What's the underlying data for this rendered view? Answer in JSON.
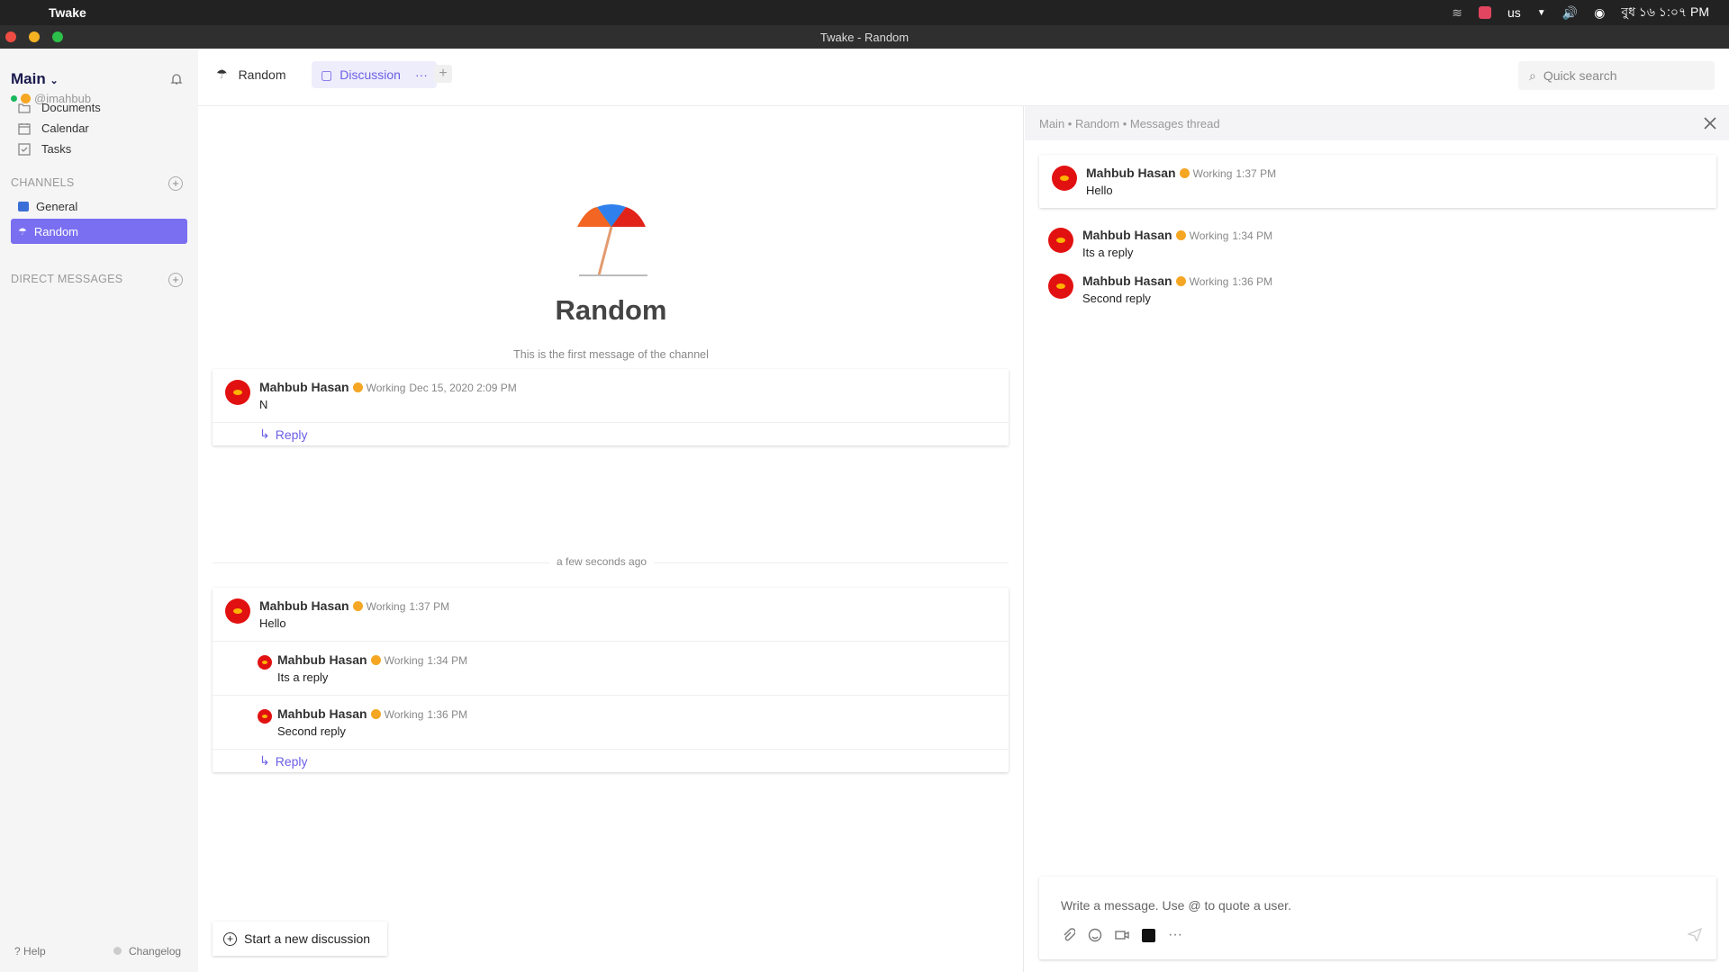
{
  "os": {
    "app_name": "Twake",
    "window_title": "Twake - Random",
    "keyboard": "us",
    "clock": "বুধ ১৬ ১:০৭ PM"
  },
  "sidebar": {
    "workspace": "Main",
    "username": "@imahbub",
    "nav": [
      {
        "label": "Documents"
      },
      {
        "label": "Calendar"
      },
      {
        "label": "Tasks"
      }
    ],
    "channels_heading": "CHANNELS",
    "channels": [
      {
        "label": "General"
      },
      {
        "label": "Random",
        "active": true
      }
    ],
    "dm_heading": "DIRECT MESSAGES",
    "help": "Help",
    "changelog": "Changelog"
  },
  "header": {
    "channel": "Random",
    "tab": "Discussion",
    "search_placeholder": "Quick search"
  },
  "intro": {
    "title": "Random",
    "subtitle": "This is the first message of the channel"
  },
  "separator": "a few seconds ago",
  "messages": [
    {
      "author": "Mahbub Hasan",
      "status": "Working",
      "time": "Dec 15, 2020 2:09 PM",
      "text": "N",
      "reply": "Reply"
    },
    {
      "author": "Mahbub Hasan",
      "status": "Working",
      "time": "1:37 PM",
      "text": "Hello",
      "reply": "Reply",
      "replies": [
        {
          "author": "Mahbub Hasan",
          "status": "Working",
          "time": "1:34 PM",
          "text": "Its a reply"
        },
        {
          "author": "Mahbub Hasan",
          "status": "Working",
          "time": "1:36 PM",
          "text": "Second reply"
        }
      ]
    }
  ],
  "new_discussion": "Start a new discussion",
  "thread": {
    "breadcrumb": "Main • Random • Messages thread",
    "root": {
      "author": "Mahbub Hasan",
      "status": "Working",
      "time": "1:37 PM",
      "text": "Hello"
    },
    "replies": [
      {
        "author": "Mahbub Hasan",
        "status": "Working",
        "time": "1:34 PM",
        "text": "Its a reply"
      },
      {
        "author": "Mahbub Hasan",
        "status": "Working",
        "time": "1:36 PM",
        "text": "Second reply"
      }
    ],
    "composer_placeholder": "Write a message. Use @ to quote a user."
  },
  "colors": {
    "accent": "#7a6ff0",
    "avatar": "#e21111",
    "online": "#16b85b"
  }
}
